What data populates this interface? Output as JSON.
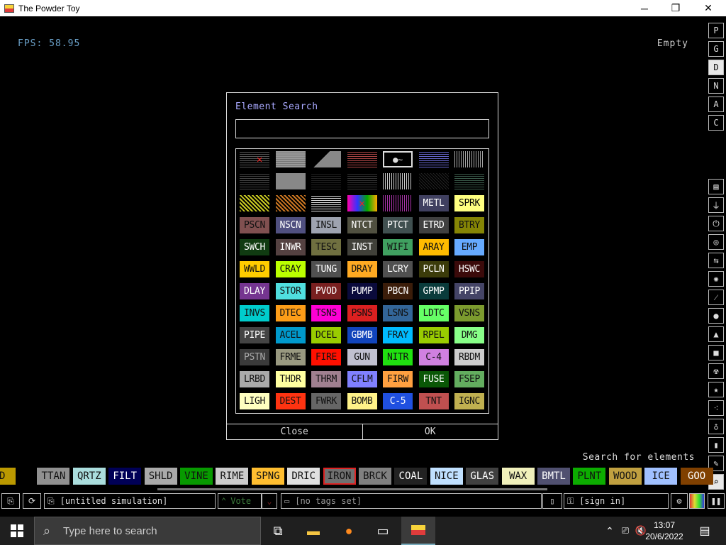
{
  "window": {
    "title": "The Powder Toy",
    "minimize_glyph": "─",
    "maximize_glyph": "❐",
    "close_glyph": "✕"
  },
  "hud": {
    "fps": "FPS: 58.95",
    "status": "Empty"
  },
  "right_menu_letters": [
    "P",
    "G",
    "D",
    "N",
    "A",
    "C"
  ],
  "dialog": {
    "title": "Element Search",
    "search_value": "",
    "close_label": "Close",
    "ok_label": "OK",
    "elements": [
      [
        "",
        "",
        "",
        "",
        "",
        "",
        ""
      ],
      [
        "",
        "",
        "",
        "",
        "",
        "",
        ""
      ],
      [
        "",
        "",
        "",
        "",
        "",
        "METL",
        "SPRK"
      ],
      [
        "PSCN",
        "NSCN",
        "INSL",
        "NTCT",
        "PTCT",
        "ETRD",
        "BTRY"
      ],
      [
        "SWCH",
        "INWR",
        "TESC",
        "INST",
        "WIFI",
        "ARAY",
        "EMP"
      ],
      [
        "WWLD",
        "CRAY",
        "TUNG",
        "DRAY",
        "LCRY",
        "PCLN",
        "HSWC"
      ],
      [
        "DLAY",
        "STOR",
        "PVOD",
        "PUMP",
        "PBCN",
        "GPMP",
        "PPIP"
      ],
      [
        "INVS",
        "DTEC",
        "TSNS",
        "PSNS",
        "LSNS",
        "LDTC",
        "VSNS"
      ],
      [
        "PIPE",
        "ACEL",
        "DCEL",
        "GBMB",
        "FRAY",
        "RPEL",
        "DMG"
      ],
      [
        "PSTN",
        "FRME",
        "FIRE",
        "GUN",
        "NITR",
        "C-4",
        "RBDM"
      ],
      [
        "LRBD",
        "THDR",
        "THRM",
        "CFLM",
        "FIRW",
        "FUSE",
        "FSEP"
      ],
      [
        "LIGH",
        "DEST",
        "FWRK",
        "BOMB",
        "C-5",
        "TNT",
        "IGNC"
      ]
    ]
  },
  "element_bar": {
    "search_label": "Search for elements",
    "items": [
      "LD",
      "TTAN",
      "QRTZ",
      "FILT",
      "SHLD",
      "VINE",
      "RIME",
      "SPNG",
      "DRIC",
      "IRON",
      "BRCK",
      "COAL",
      "NICE",
      "GLAS",
      "WAX",
      "BMTL",
      "PLNT",
      "WOOD",
      "ICE",
      "GOO"
    ],
    "selected": "IRON"
  },
  "control_bar": {
    "sim_name": "[untitled simulation]",
    "vote_label": "Vote",
    "tags": "[no tags set]",
    "sign_in": "[sign in]"
  },
  "taskbar": {
    "search_placeholder": "Type here to search",
    "time": "13:07",
    "date": "20/6/2022"
  },
  "colors": {
    "accent_title": "#a9a9ff",
    "fps": "#6aa0c8",
    "selected_outline": "#dd2222"
  }
}
